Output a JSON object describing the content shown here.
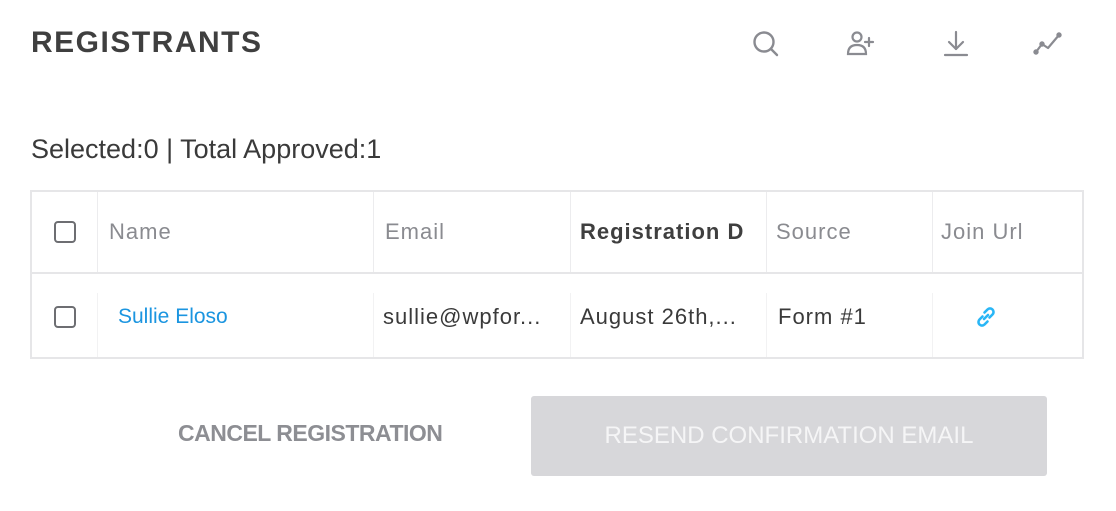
{
  "header": {
    "title": "REGISTRANTS",
    "toolbar": [
      {
        "icon": "search-icon",
        "label": "Search"
      },
      {
        "icon": "add-user-icon",
        "label": "Add registrant"
      },
      {
        "icon": "download-icon",
        "label": "Download"
      },
      {
        "icon": "analytics-icon",
        "label": "Analytics"
      }
    ]
  },
  "summary": {
    "text": "Selected:0 | Total Approved:1",
    "selected": 0,
    "total_approved": 1
  },
  "table": {
    "columns": [
      "Name",
      "Email",
      "Registration D",
      "Source",
      "Join Url"
    ],
    "sorted_column": "Registration Date",
    "rows": [
      {
        "checked": false,
        "name": "Sullie Eloso",
        "email": "sullie@wpfor...",
        "registration_date": "August 26th,...",
        "source": "Form #1",
        "join_url_icon": "link-icon"
      }
    ]
  },
  "actions": {
    "cancel_label": "CANCEL REGISTRATION",
    "resend_label": "RESEND CONFIRMATION EMAIL",
    "resend_disabled": true
  },
  "colors": {
    "link": "#1b95e0",
    "join_icon": "#29b6f6",
    "icon_gray": "#8a8b91",
    "disabled_button": "#d7d7da"
  }
}
